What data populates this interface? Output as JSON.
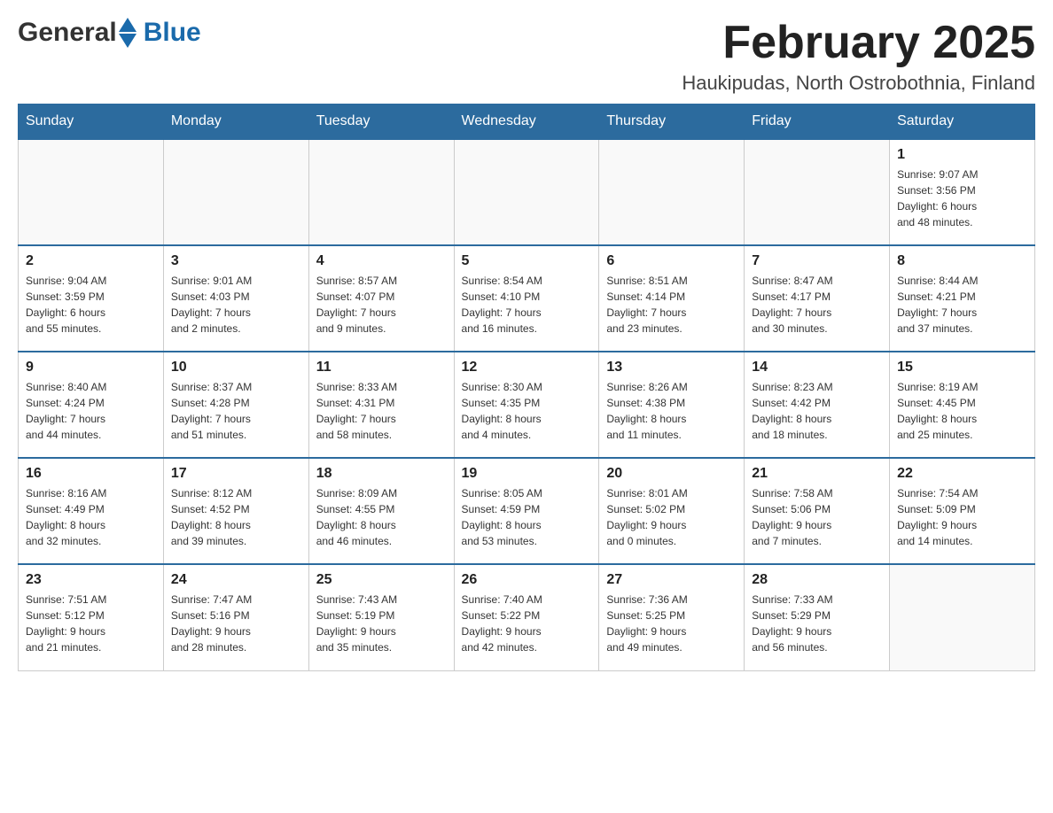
{
  "header": {
    "logo_general": "General",
    "logo_blue": "Blue",
    "month_title": "February 2025",
    "location": "Haukipudas, North Ostrobothnia, Finland"
  },
  "days_of_week": [
    "Sunday",
    "Monday",
    "Tuesday",
    "Wednesday",
    "Thursday",
    "Friday",
    "Saturday"
  ],
  "weeks": [
    [
      {
        "day": "",
        "info": ""
      },
      {
        "day": "",
        "info": ""
      },
      {
        "day": "",
        "info": ""
      },
      {
        "day": "",
        "info": ""
      },
      {
        "day": "",
        "info": ""
      },
      {
        "day": "",
        "info": ""
      },
      {
        "day": "1",
        "info": "Sunrise: 9:07 AM\nSunset: 3:56 PM\nDaylight: 6 hours\nand 48 minutes."
      }
    ],
    [
      {
        "day": "2",
        "info": "Sunrise: 9:04 AM\nSunset: 3:59 PM\nDaylight: 6 hours\nand 55 minutes."
      },
      {
        "day": "3",
        "info": "Sunrise: 9:01 AM\nSunset: 4:03 PM\nDaylight: 7 hours\nand 2 minutes."
      },
      {
        "day": "4",
        "info": "Sunrise: 8:57 AM\nSunset: 4:07 PM\nDaylight: 7 hours\nand 9 minutes."
      },
      {
        "day": "5",
        "info": "Sunrise: 8:54 AM\nSunset: 4:10 PM\nDaylight: 7 hours\nand 16 minutes."
      },
      {
        "day": "6",
        "info": "Sunrise: 8:51 AM\nSunset: 4:14 PM\nDaylight: 7 hours\nand 23 minutes."
      },
      {
        "day": "7",
        "info": "Sunrise: 8:47 AM\nSunset: 4:17 PM\nDaylight: 7 hours\nand 30 minutes."
      },
      {
        "day": "8",
        "info": "Sunrise: 8:44 AM\nSunset: 4:21 PM\nDaylight: 7 hours\nand 37 minutes."
      }
    ],
    [
      {
        "day": "9",
        "info": "Sunrise: 8:40 AM\nSunset: 4:24 PM\nDaylight: 7 hours\nand 44 minutes."
      },
      {
        "day": "10",
        "info": "Sunrise: 8:37 AM\nSunset: 4:28 PM\nDaylight: 7 hours\nand 51 minutes."
      },
      {
        "day": "11",
        "info": "Sunrise: 8:33 AM\nSunset: 4:31 PM\nDaylight: 7 hours\nand 58 minutes."
      },
      {
        "day": "12",
        "info": "Sunrise: 8:30 AM\nSunset: 4:35 PM\nDaylight: 8 hours\nand 4 minutes."
      },
      {
        "day": "13",
        "info": "Sunrise: 8:26 AM\nSunset: 4:38 PM\nDaylight: 8 hours\nand 11 minutes."
      },
      {
        "day": "14",
        "info": "Sunrise: 8:23 AM\nSunset: 4:42 PM\nDaylight: 8 hours\nand 18 minutes."
      },
      {
        "day": "15",
        "info": "Sunrise: 8:19 AM\nSunset: 4:45 PM\nDaylight: 8 hours\nand 25 minutes."
      }
    ],
    [
      {
        "day": "16",
        "info": "Sunrise: 8:16 AM\nSunset: 4:49 PM\nDaylight: 8 hours\nand 32 minutes."
      },
      {
        "day": "17",
        "info": "Sunrise: 8:12 AM\nSunset: 4:52 PM\nDaylight: 8 hours\nand 39 minutes."
      },
      {
        "day": "18",
        "info": "Sunrise: 8:09 AM\nSunset: 4:55 PM\nDaylight: 8 hours\nand 46 minutes."
      },
      {
        "day": "19",
        "info": "Sunrise: 8:05 AM\nSunset: 4:59 PM\nDaylight: 8 hours\nand 53 minutes."
      },
      {
        "day": "20",
        "info": "Sunrise: 8:01 AM\nSunset: 5:02 PM\nDaylight: 9 hours\nand 0 minutes."
      },
      {
        "day": "21",
        "info": "Sunrise: 7:58 AM\nSunset: 5:06 PM\nDaylight: 9 hours\nand 7 minutes."
      },
      {
        "day": "22",
        "info": "Sunrise: 7:54 AM\nSunset: 5:09 PM\nDaylight: 9 hours\nand 14 minutes."
      }
    ],
    [
      {
        "day": "23",
        "info": "Sunrise: 7:51 AM\nSunset: 5:12 PM\nDaylight: 9 hours\nand 21 minutes."
      },
      {
        "day": "24",
        "info": "Sunrise: 7:47 AM\nSunset: 5:16 PM\nDaylight: 9 hours\nand 28 minutes."
      },
      {
        "day": "25",
        "info": "Sunrise: 7:43 AM\nSunset: 5:19 PM\nDaylight: 9 hours\nand 35 minutes."
      },
      {
        "day": "26",
        "info": "Sunrise: 7:40 AM\nSunset: 5:22 PM\nDaylight: 9 hours\nand 42 minutes."
      },
      {
        "day": "27",
        "info": "Sunrise: 7:36 AM\nSunset: 5:25 PM\nDaylight: 9 hours\nand 49 minutes."
      },
      {
        "day": "28",
        "info": "Sunrise: 7:33 AM\nSunset: 5:29 PM\nDaylight: 9 hours\nand 56 minutes."
      },
      {
        "day": "",
        "info": ""
      }
    ]
  ]
}
